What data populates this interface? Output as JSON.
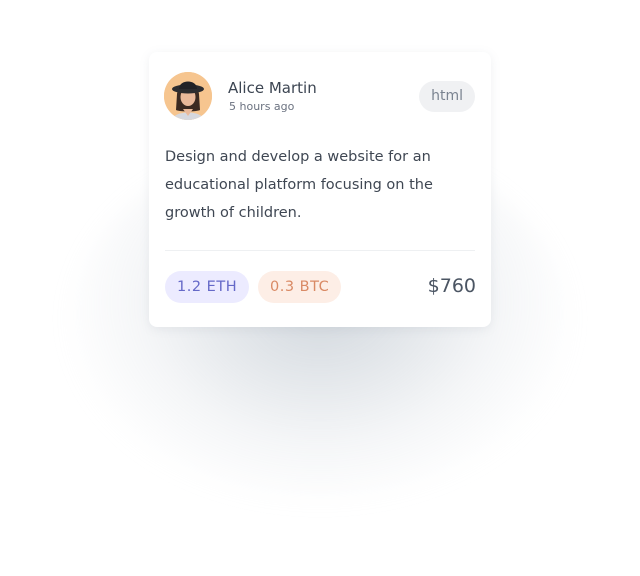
{
  "card": {
    "user": {
      "name": "Alice Martin",
      "time": "5 hours ago",
      "avatar_icon": "person-with-hat-avatar"
    },
    "tag": "html",
    "description": "Design and develop a website for an educational platform focusing on the growth of children.",
    "payments": [
      {
        "label": "1.2 ETH",
        "color": "#6569c8",
        "background": "#ecebff"
      },
      {
        "label": "0.3 BTC",
        "color": "#d98a65",
        "background": "#fdeee6"
      }
    ],
    "price": "$760"
  },
  "colors": {
    "avatar_background": "#f6c58f",
    "divider": "#eef0f2",
    "text_primary": "#3c4552",
    "text_secondary": "#6b7280"
  }
}
